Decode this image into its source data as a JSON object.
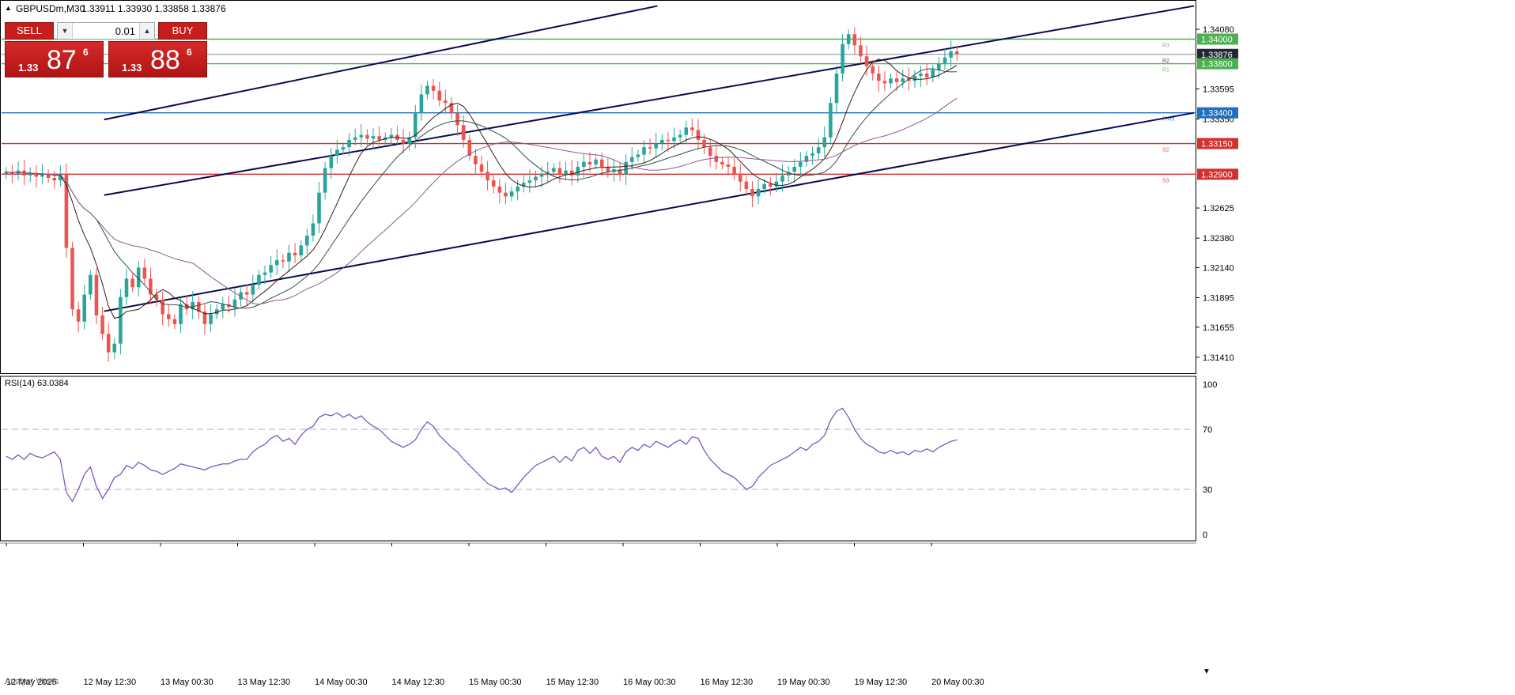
{
  "header": {
    "symbol": "GBPUSDm,M30",
    "ohlc": "1.33911 1.33930 1.33858 1.33876",
    "triangle_icon": "triangle-up-icon"
  },
  "trade_panel": {
    "sell_label": "SELL",
    "buy_label": "BUY",
    "lot_value": "0.01",
    "decrease_icon": "caret-down-icon",
    "increase_icon": "caret-up-icon",
    "bid": {
      "prefix": "1.33",
      "big": "87",
      "sup": "6"
    },
    "ask": {
      "prefix": "1.33",
      "big": "88",
      "sup": "6"
    }
  },
  "indicator": {
    "label": "RSI(14) 63.0384"
  },
  "bottom_tab": {
    "label": "Analyst Views"
  },
  "colors": {
    "bull_candle": "#26a69a",
    "bear_candle": "#ef5350",
    "channel": "#0a0a50",
    "support_resistance_green": "#4caf50",
    "pivot_blue": "#1e6fbf",
    "support_red": "#d32f2f",
    "rsi_line": "#7e57c2",
    "ma_dark": "#3b1a10",
    "ma_gray": "#2f4f4f",
    "ma_purple": "#8e5a8e"
  },
  "chart_data": [
    {
      "type": "candlestick",
      "symbol": "GBPUSDm",
      "timeframe": "M30",
      "y_ticks": [
        "1.34080",
        "1.33595",
        "1.33350",
        "1.32625",
        "1.32380",
        "1.32140",
        "1.31895",
        "1.31655",
        "1.31410"
      ],
      "ylim": [
        1.3128,
        1.3428
      ],
      "x_ticks": [
        "12 May 2025",
        "12 May 12:30",
        "13 May 00:30",
        "13 May 12:30",
        "14 May 00:30",
        "14 May 12:30",
        "15 May 00:30",
        "15 May 12:30",
        "16 May 00:30",
        "16 May 12:30",
        "19 May 00:30",
        "19 May 12:30",
        "20 May 00:30"
      ],
      "price_levels": [
        {
          "price": 1.34,
          "label": "1.34000",
          "color": "#4caf50",
          "pivot": "R3"
        },
        {
          "price": 1.33876,
          "label": "1.33876",
          "color": "#222831",
          "pivot": "R2",
          "current": true
        },
        {
          "price": 1.338,
          "label": "1.33800",
          "color": "#4caf50",
          "pivot": "R1"
        },
        {
          "price": 1.334,
          "label": "1.33400",
          "color": "#1e6fbf",
          "pivot": "Pivot"
        },
        {
          "price": 1.3315,
          "label": "1.33150",
          "color": "#d32f2f",
          "pivot": "S2"
        },
        {
          "price": 1.329,
          "label": "1.32900",
          "color": "#d32f2f",
          "pivot": "S3"
        }
      ],
      "channel_lines": [
        {
          "name": "upper",
          "from": [
            0.086,
            1.33345
          ],
          "to": [
            0.55,
            1.3427
          ]
        },
        {
          "name": "middle",
          "from": [
            0.086,
            1.3273
          ],
          "to": [
            1.0,
            1.3427
          ]
        },
        {
          "name": "lower",
          "from": [
            0.086,
            1.31785
          ],
          "to": [
            1.0,
            1.334
          ]
        }
      ],
      "close_series": [
        1.3292,
        1.329,
        1.3293,
        1.3289,
        1.3291,
        1.3288,
        1.329,
        1.3287,
        1.3285,
        1.329,
        1.323,
        1.318,
        1.317,
        1.3192,
        1.3208,
        1.3175,
        1.316,
        1.3145,
        1.3152,
        1.319,
        1.3205,
        1.3198,
        1.3214,
        1.3205,
        1.3192,
        1.3188,
        1.3176,
        1.3172,
        1.3168,
        1.3184,
        1.318,
        1.3186,
        1.3178,
        1.3168,
        1.3176,
        1.318,
        1.3184,
        1.3182,
        1.3188,
        1.3194,
        1.3192,
        1.32,
        1.3208,
        1.321,
        1.3216,
        1.322,
        1.3219,
        1.3226,
        1.3224,
        1.3232,
        1.324,
        1.325,
        1.3275,
        1.3295,
        1.3305,
        1.331,
        1.3312,
        1.3318,
        1.332,
        1.3322,
        1.3319,
        1.3321,
        1.3318,
        1.332,
        1.3322,
        1.3318,
        1.3315,
        1.332,
        1.334,
        1.3355,
        1.3362,
        1.3358,
        1.335,
        1.3348,
        1.334,
        1.333,
        1.3318,
        1.3305,
        1.3298,
        1.3292,
        1.3285,
        1.328,
        1.3275,
        1.3272,
        1.3276,
        1.328,
        1.3283,
        1.3285,
        1.3288,
        1.329,
        1.3292,
        1.3295,
        1.329,
        1.3293,
        1.3289,
        1.3296,
        1.33,
        1.3298,
        1.3302,
        1.3296,
        1.3292,
        1.3294,
        1.329,
        1.33,
        1.3304,
        1.3306,
        1.3312,
        1.3311,
        1.3315,
        1.3318,
        1.3317,
        1.332,
        1.3322,
        1.3328,
        1.3326,
        1.3318,
        1.3312,
        1.3305,
        1.33,
        1.3298,
        1.3296,
        1.329,
        1.3284,
        1.3278,
        1.3272,
        1.3278,
        1.3282,
        1.328,
        1.3284,
        1.3289,
        1.3292,
        1.3296,
        1.33,
        1.3305,
        1.3307,
        1.3312,
        1.332,
        1.3348,
        1.3372,
        1.3396,
        1.3404,
        1.3395,
        1.3386,
        1.3378,
        1.3372,
        1.3366,
        1.3364,
        1.3368,
        1.3365,
        1.3368,
        1.3366,
        1.337,
        1.3372,
        1.3369,
        1.3375,
        1.338,
        1.3385,
        1.339,
        1.3388
      ]
    },
    {
      "type": "line",
      "name": "RSI(14)",
      "current": 63.0384,
      "levels": [
        70,
        30
      ],
      "y_ticks": [
        "100",
        "70",
        "30",
        "0"
      ],
      "ylim": [
        0,
        100
      ],
      "values": [
        52,
        50,
        53,
        50,
        54,
        52,
        51,
        53,
        55,
        50,
        28,
        22,
        30,
        40,
        45,
        32,
        24,
        30,
        38,
        40,
        46,
        44,
        48,
        46,
        43,
        42,
        40,
        42,
        44,
        47,
        46,
        45,
        44,
        43,
        45,
        46,
        47,
        47,
        49,
        50,
        50,
        55,
        58,
        60,
        64,
        66,
        62,
        64,
        60,
        66,
        70,
        72,
        78,
        80,
        79,
        81,
        78,
        80,
        77,
        79,
        75,
        72,
        70,
        66,
        62,
        60,
        58,
        60,
        63,
        70,
        75,
        72,
        66,
        62,
        58,
        55,
        50,
        46,
        42,
        38,
        34,
        32,
        30,
        31,
        28,
        33,
        38,
        42,
        46,
        48,
        50,
        52,
        48,
        52,
        49,
        56,
        58,
        54,
        58,
        52,
        50,
        52,
        48,
        55,
        58,
        56,
        60,
        58,
        62,
        60,
        58,
        61,
        63,
        60,
        65,
        64,
        56,
        50,
        46,
        42,
        40,
        38,
        34,
        30,
        32,
        38,
        42,
        46,
        48,
        50,
        52,
        55,
        58,
        56,
        60,
        62,
        66,
        76,
        82,
        84,
        78,
        70,
        64,
        60,
        58,
        55,
        54,
        56,
        54,
        55,
        53,
        56,
        55,
        57,
        55,
        58,
        60,
        62,
        63
      ]
    }
  ]
}
